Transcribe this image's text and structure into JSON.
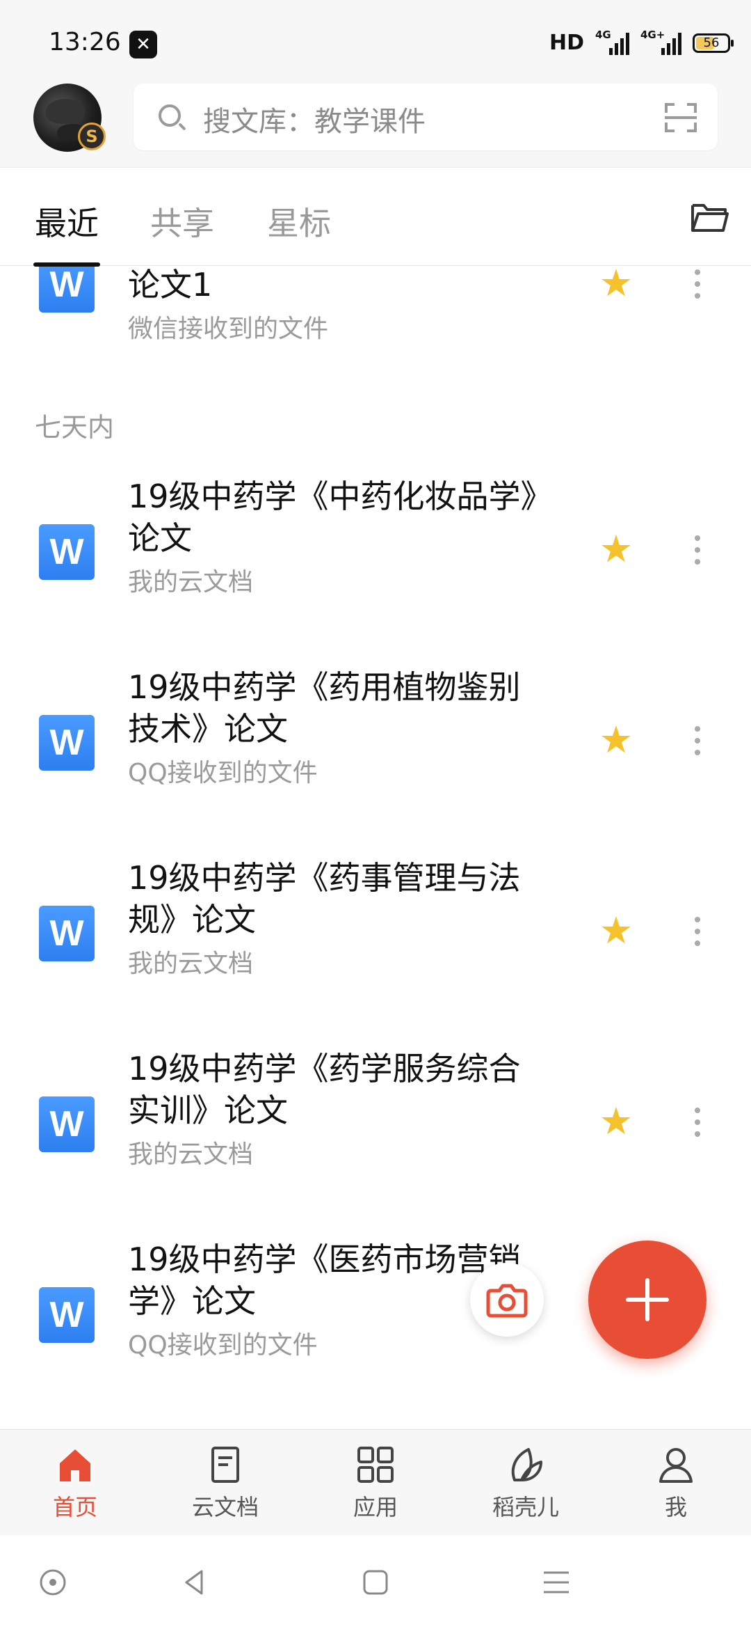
{
  "status_bar": {
    "time": "13:26",
    "hd": "HD",
    "signal1_label": "4G",
    "signal2_label": "4G+",
    "battery": "56"
  },
  "header": {
    "search_placeholder": "搜文库：教学课件",
    "avatar_badge": "S"
  },
  "tabs": [
    {
      "label": "最近",
      "active": true
    },
    {
      "label": "共享",
      "active": false
    },
    {
      "label": "星标",
      "active": false
    }
  ],
  "sections": {
    "week": "七天内"
  },
  "files": [
    {
      "name": "论文1",
      "source": "微信接收到的文件",
      "starred": true
    },
    {
      "name": "19级中药学《中药化妆品学》论文",
      "source": "我的云文档",
      "starred": true
    },
    {
      "name": "19级中药学《药用植物鉴别技术》论文",
      "source": "QQ接收到的文件",
      "starred": true
    },
    {
      "name": "19级中药学《药事管理与法规》论文",
      "source": "我的云文档",
      "starred": true
    },
    {
      "name": "19级中药学《药学服务综合实训》论文",
      "source": "我的云文档",
      "starred": true
    },
    {
      "name": "19级中药学《医药市场营销学》论文",
      "source": "QQ接收到的文件",
      "starred": false
    }
  ],
  "doc_icon_letter": "W",
  "bottom_nav": [
    {
      "label": "首页",
      "icon": "home-icon",
      "active": true
    },
    {
      "label": "云文档",
      "icon": "document-icon",
      "active": false
    },
    {
      "label": "应用",
      "icon": "apps-grid-icon",
      "active": false
    },
    {
      "label": "稻壳儿",
      "icon": "leaf-icon",
      "active": false
    },
    {
      "label": "我",
      "icon": "person-icon",
      "active": false
    }
  ],
  "colors": {
    "accent": "#e84d35",
    "word_blue": "#2d7ff0",
    "star": "#f5c22b"
  }
}
